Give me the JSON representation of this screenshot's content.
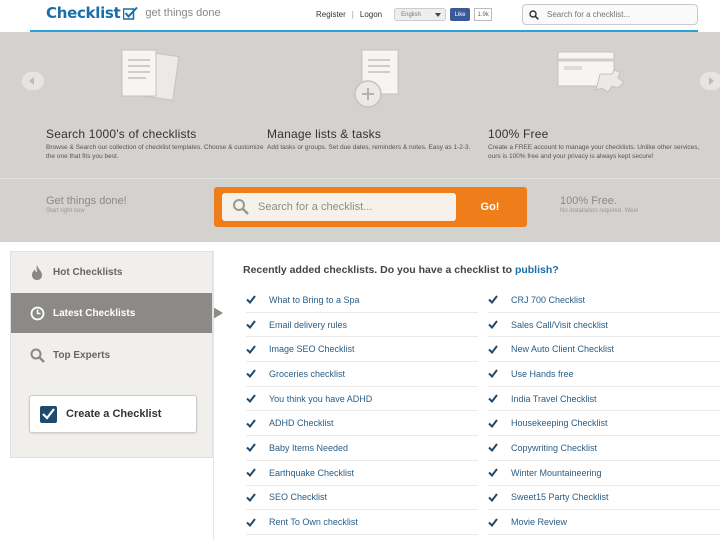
{
  "header": {
    "logo": "Checklist",
    "tagline": "get things done",
    "register": "Register",
    "logon": "Logon",
    "language": "English",
    "like_label": "Like",
    "like_count": "1.9k",
    "search_placeholder": "Search for a checklist..."
  },
  "hero": {
    "features": [
      {
        "title": "Search 1000's of checklists",
        "text": "Browse & Search our collection of checklist templates. Choose & customize the one that fits you best."
      },
      {
        "title": "Manage lists & tasks",
        "text": "Add tasks or groups. Set due dates, reminders & notes. Easy as 1-2-3."
      },
      {
        "title": "100% Free",
        "text": "Create a FREE account to manage your checklists. Unlike other services, ours is 100% free and your privacy is always kept secure!"
      }
    ],
    "faded_left": {
      "title": "Get things done!",
      "sub": "Start right now"
    },
    "faded_right": {
      "title": "100% Free.",
      "sub": "No installation required. Wee!"
    },
    "search_placeholder": "Search for a checklist...",
    "go_label": "Go!"
  },
  "sidebar": {
    "items": [
      {
        "label": "Hot Checklists",
        "icon": "fire-icon"
      },
      {
        "label": "Latest Checklists",
        "icon": "clock-icon"
      },
      {
        "label": "Top Experts",
        "icon": "magnifier-icon"
      }
    ],
    "active_index": 1,
    "create_label": "Create a Checklist"
  },
  "main": {
    "title_prefix": "Recently added checklists. Do you have a checklist to ",
    "title_link": "publish?",
    "col1": [
      "What to Bring to a Spa",
      "Email delivery rules",
      "Image SEO Checklist",
      "Groceries checklist",
      "You think you have ADHD",
      "ADHD Checklist",
      "Baby Items Needed",
      "Earthquake Checklist",
      "SEO Checklist",
      "Rent To Own checklist"
    ],
    "col2": [
      "CRJ 700 Checklist",
      "Sales Call/Visit checklist",
      "New Auto Client Checklist",
      "Use Hands free",
      "India Travel Checklist",
      "Housekeeping Checklist",
      "Copywriting Checklist",
      "Winter Mountaineering",
      "Sweet15 Party Checklist",
      "Movie Review"
    ]
  },
  "colors": {
    "brand_blue": "#1a6fa8",
    "accent_bar": "#2aa2d8",
    "orange": "#ef7d1a",
    "hero_bg": "#d4d2cf",
    "sidebar_active": "#8b8a86"
  }
}
